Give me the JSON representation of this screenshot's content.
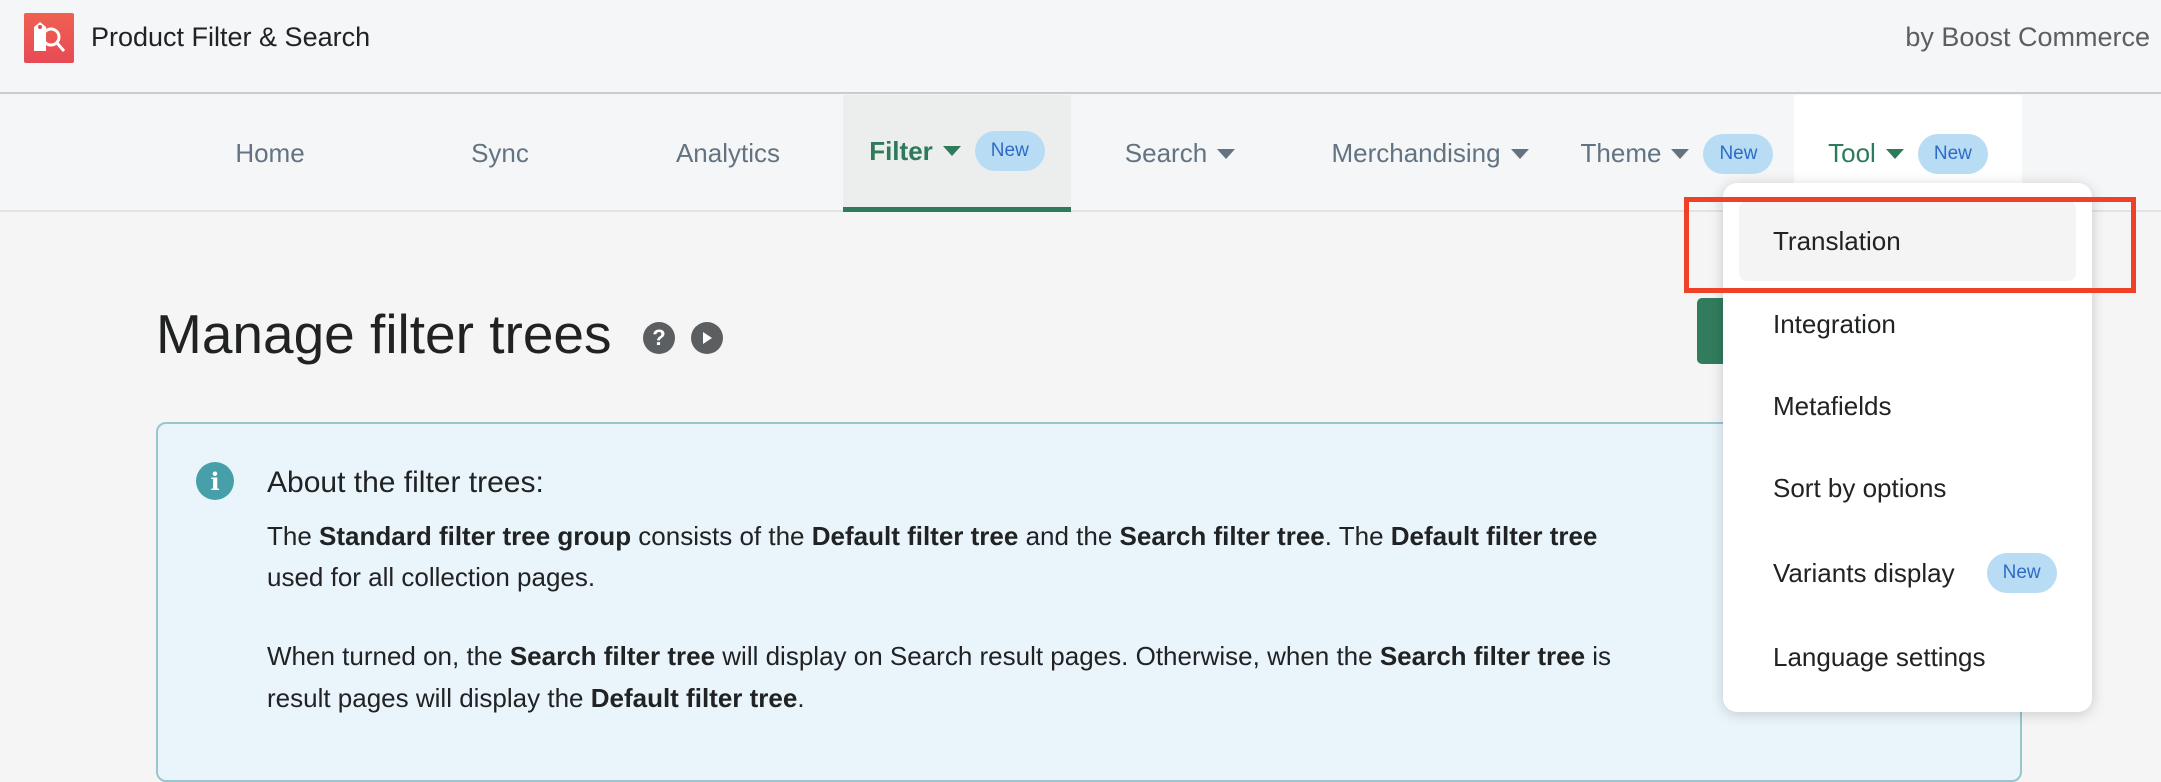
{
  "app": {
    "title": "Product Filter & Search",
    "vendor": "by Boost Commerce",
    "logo_icon": "tag-search-icon"
  },
  "nav": {
    "items": [
      {
        "label": "Home"
      },
      {
        "label": "Sync"
      },
      {
        "label": "Analytics"
      },
      {
        "label": "Filter",
        "badge": "New",
        "active": true
      },
      {
        "label": "Search"
      },
      {
        "label": "Merchandising"
      },
      {
        "label": "Theme",
        "badge": "New"
      },
      {
        "label": "Tool",
        "badge": "New",
        "open": true
      }
    ]
  },
  "page": {
    "title": "Manage filter trees",
    "help_icon": "?",
    "video_icon": "play-icon"
  },
  "info": {
    "title": "About the filter trees:",
    "line1": [
      "The ",
      "Standard filter tree group",
      " consists of the ",
      "Default filter tree",
      " and the ",
      "Search filter tree",
      ". The ",
      "Default filter tree"
    ],
    "line2": "used for all collection pages.",
    "line3": [
      "When turned on, the ",
      "Search filter tree",
      " will display on Search result pages. Otherwise, when the ",
      "Search filter tree",
      " is"
    ],
    "line4": [
      "result pages will display the ",
      "Default filter tree",
      "."
    ]
  },
  "menu": {
    "items": [
      {
        "label": "Translation",
        "highlighted": true
      },
      {
        "label": "Integration"
      },
      {
        "label": "Metafields"
      },
      {
        "label": "Sort by options"
      },
      {
        "label": "Variants display",
        "badge": "New"
      },
      {
        "label": "Language settings"
      }
    ]
  },
  "colors": {
    "accent": "#2f7a5b",
    "badge_bg": "#b9dcf5",
    "highlight": "#ee4127"
  }
}
